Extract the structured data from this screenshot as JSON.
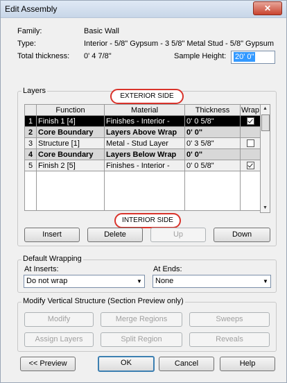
{
  "window": {
    "title": "Edit Assembly",
    "close": "✕"
  },
  "info": {
    "family_label": "Family:",
    "family_value": "Basic Wall",
    "type_label": "Type:",
    "type_value": "Interior - 5/8\" Gypsum - 3 5/8\" Metal Stud - 5/8\" Gypsum",
    "thickness_label": "Total thickness:",
    "thickness_value": "0'  4 7/8\"",
    "sample_height_label": "Sample Height:",
    "sample_height_value": "20'  0\""
  },
  "layers": {
    "group_title": "Layers",
    "exterior_label": "EXTERIOR SIDE",
    "interior_label": "INTERIOR SIDE",
    "columns": [
      "",
      "Function",
      "Material",
      "Thickness",
      "Wrap"
    ],
    "rows": [
      {
        "num": "1",
        "function": "Finish 1 [4]",
        "material": "Finishes - Interior -",
        "thickness": "0'  0 5/8\"",
        "wrap": true
      },
      {
        "num": "2",
        "function": "Core Boundary",
        "material": "Layers Above Wrap",
        "thickness": "0'  0\"",
        "wrap": null
      },
      {
        "num": "3",
        "function": "Structure [1]",
        "material": "Metal - Stud Layer",
        "thickness": "0'  3 5/8\"",
        "wrap": false
      },
      {
        "num": "4",
        "function": "Core Boundary",
        "material": "Layers Below Wrap",
        "thickness": "0'  0\"",
        "wrap": null
      },
      {
        "num": "5",
        "function": "Finish 2 [5]",
        "material": "Finishes - Interior -",
        "thickness": "0'  0 5/8\"",
        "wrap": true
      }
    ]
  },
  "buttons": {
    "insert": "Insert",
    "delete": "Delete",
    "up": "Up",
    "down": "Down"
  },
  "wrapping": {
    "group_title": "Default Wrapping",
    "at_inserts_label": "At Inserts:",
    "at_inserts_value": "Do not wrap",
    "at_ends_label": "At Ends:",
    "at_ends_value": "None"
  },
  "modify": {
    "group_title": "Modify Vertical Structure (Section Preview only)",
    "modify": "Modify",
    "merge_regions": "Merge Regions",
    "sweeps": "Sweeps",
    "assign_layers": "Assign Layers",
    "split_region": "Split Region",
    "reveals": "Reveals"
  },
  "footer": {
    "preview": "<< Preview",
    "ok": "OK",
    "cancel": "Cancel",
    "help": "Help"
  }
}
